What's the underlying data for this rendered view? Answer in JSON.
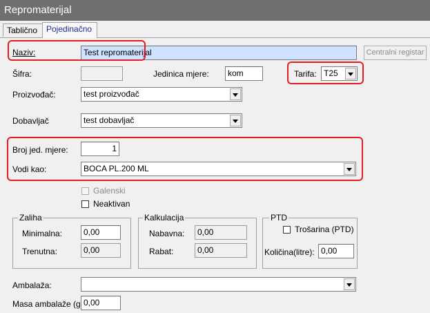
{
  "window": {
    "title": "Repromaterijal"
  },
  "tabs": [
    {
      "label": "Tablično"
    },
    {
      "label": "Pojedinačno"
    }
  ],
  "form": {
    "naziv": {
      "label": "Naziv:",
      "value": "Test repromaterijal"
    },
    "centralni_registar": {
      "label": "Centralni registar"
    },
    "sifra": {
      "label": "Šifra:",
      "value": ""
    },
    "jedinica_mjere": {
      "label": "Jedinica mjere:",
      "value": "kom"
    },
    "tarifa": {
      "label": "Tarifa:",
      "value": "T25"
    },
    "proizvodjac": {
      "label": "Proizvođač:",
      "value": "test proizvođač"
    },
    "dobavljac": {
      "label": "Dobavljač",
      "value": "test dobavljač"
    },
    "broj_jed_mjere": {
      "label": "Broj jed. mjere:",
      "value": "1"
    },
    "vodi_kao": {
      "label": "Vodi kao:",
      "value": "BOCA PL.200 ML"
    },
    "galenski": {
      "label": "Galenski",
      "checked": false,
      "enabled": false
    },
    "neaktivan": {
      "label": "Neaktivan",
      "checked": false
    },
    "zaliha": {
      "title": "Zaliha",
      "minimalna": {
        "label": "Minimalna:",
        "value": "0,00"
      },
      "trenutna": {
        "label": "Trenutna:",
        "value": "0,00"
      }
    },
    "kalkulacija": {
      "title": "Kalkulacija",
      "nabavna": {
        "label": "Nabavna:",
        "value": "0,00"
      },
      "rabat": {
        "label": "Rabat:",
        "value": "0,00"
      }
    },
    "ptd": {
      "title": "PTD",
      "trosarina": {
        "label": "Trošarina (PTD)",
        "checked": false
      },
      "kolicina": {
        "label": "Količina(litre):",
        "value": "0,00"
      }
    },
    "ambalaza": {
      "label": "Ambalaža:",
      "value": ""
    },
    "masa_ambalaze": {
      "label": "Masa ambalaže (g):",
      "value": "0,00"
    }
  },
  "colors": {
    "highlight": "#e41d24",
    "titlebar": "#6f6f6f",
    "selection": "#cfe2ff",
    "active_tab_text": "#1c2f8f"
  }
}
